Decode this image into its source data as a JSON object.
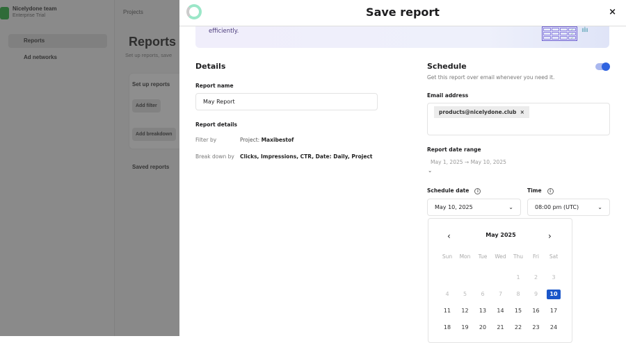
{
  "background": {
    "team": "Nicelydone team",
    "plan": "Enterprise Trial",
    "projects": "Projects",
    "nav": [
      "Reports",
      "Ad networks"
    ],
    "title": "Reports",
    "subtitle": "Set up reports, save",
    "setup_title": "Set up reports",
    "add_filter": "Add filter",
    "add_breakdown": "Add breakdown",
    "saved_reports": "Saved reports"
  },
  "modal": {
    "title": "Save report",
    "close": "×",
    "banner_text": "efficiently."
  },
  "details": {
    "heading": "Details",
    "report_name_label": "Report name",
    "report_name": "May Report",
    "report_details_label": "Report details",
    "filter_label": "Filter by",
    "filter_prefix": "Project:",
    "filter_value": "Maxibestof",
    "breakdown_label": "Break down by",
    "breakdown_value": "Clicks, Impressions, CTR, Date: Daily, Project"
  },
  "schedule": {
    "heading": "Schedule",
    "enabled": true,
    "description": "Get this report over email whenever you need it.",
    "email_label": "Email address",
    "email": "products@nicelydone.club",
    "email_remove": "×",
    "range_label": "Report date range",
    "range_value": "May 1, 2025 → May 10, 2025",
    "date_label": "Schedule date",
    "date_value": "May 10, 2025",
    "time_label": "Time",
    "time_value": "08:00 pm (UTC)"
  },
  "calendar": {
    "month": "May 2025",
    "prev": "‹",
    "next": "›",
    "weekdays": [
      "Sun",
      "Mon",
      "Tue",
      "Wed",
      "Thu",
      "Fri",
      "Sat"
    ],
    "selected": 10,
    "rows": [
      [
        "",
        "",
        "",
        "",
        "1",
        "2",
        "3"
      ],
      [
        "4",
        "5",
        "6",
        "7",
        "8",
        "9",
        "10"
      ],
      [
        "11",
        "12",
        "13",
        "14",
        "15",
        "16",
        "17"
      ],
      [
        "18",
        "19",
        "20",
        "21",
        "22",
        "23",
        "24"
      ]
    ],
    "disabled_before": 10
  }
}
